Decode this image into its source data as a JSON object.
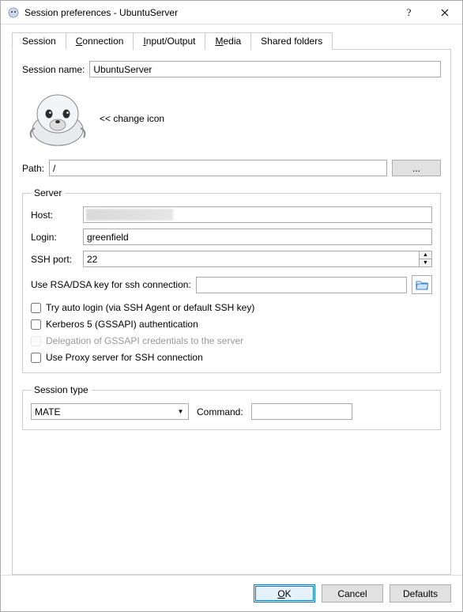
{
  "title": "Session preferences - UbuntuServer",
  "tabs": {
    "session": "Session",
    "connection": "Connection",
    "io": "Input/Output",
    "media": "Media",
    "shared": "Shared folders"
  },
  "session_name_label": "Session name:",
  "session_name_value": "UbuntuServer",
  "change_icon": "<< change icon",
  "path_label": "Path:",
  "path_value": "/",
  "browse_label": "...",
  "server": {
    "legend": "Server",
    "host_label": "Host:",
    "host_value": "",
    "login_label": "Login:",
    "login_value": "greenfield",
    "sshport_label": "SSH port:",
    "sshport_value": "22",
    "rsa_label": "Use RSA/DSA key for ssh connection:",
    "rsa_value": "",
    "chk_autologin": "Try auto login (via SSH Agent or default SSH key)",
    "chk_kerberos": "Kerberos 5 (GSSAPI) authentication",
    "chk_delegation": "Delegation of GSSAPI credentials to the server",
    "chk_proxy": "Use Proxy server for SSH connection"
  },
  "session_type": {
    "legend": "Session type",
    "selected": "MATE",
    "command_label": "Command:",
    "command_value": ""
  },
  "buttons": {
    "ok": "OK",
    "cancel": "Cancel",
    "defaults": "Defaults"
  }
}
